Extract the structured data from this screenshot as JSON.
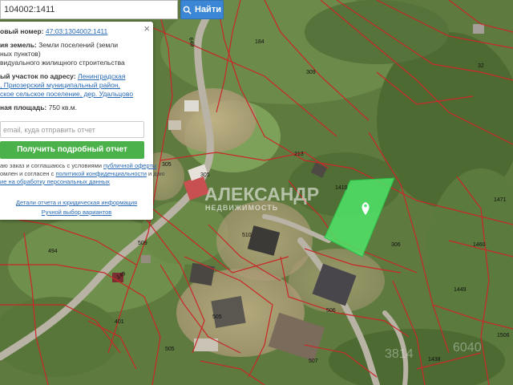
{
  "search": {
    "value": "104002:1411",
    "button_label": "Найти",
    "button_icon": "search-icon"
  },
  "panel": {
    "close_glyph": "×",
    "cad_label": "овый номер:",
    "cad_value": "47:03:1304002:1411",
    "category_label": "ия земель:",
    "category_value_1": "Земли поселений (земли",
    "category_value_2": "ных пунктов)",
    "use_value": "видуального жилищного строительства",
    "address_label": "ый участок по адресу:",
    "address_1": "Ленинградская",
    "address_2": ", Приозерский муниципальный район,",
    "address_3": "ское сельское поселение, дер. Удальцово",
    "area_label": "ная площадь:",
    "area_value": "750 кв.м.",
    "email_placeholder": "email, куда отправить отчет",
    "cta_label": "Получить подробный отчет",
    "consent_1a": "аю заказ и соглашаюсь с условиями ",
    "consent_1b": "публичной оферты",
    "consent_2a": "омлен и согласен с ",
    "consent_2b": "политикой конфиденциальности",
    "consent_2c": " и даю",
    "consent_3": "ие на обработку персональных данных",
    "link_details": "Детали отчета и юридическая информация",
    "link_manual": "Ручной выбор вариантов"
  },
  "map": {
    "plot_labels": [
      "184",
      "309",
      "32",
      "213",
      "1410",
      "305",
      "305",
      "1471",
      "510",
      "306",
      "1460",
      "509",
      "494",
      "401",
      "506",
      "1449",
      "505",
      "1506",
      "505",
      "507",
      "1438",
      "149",
      "649"
    ],
    "watermark_1": "АЛЕКСАНДР",
    "watermark_2": "НЕДВИЖИМОСТЬ",
    "watermark_3": "3814",
    "watermark_4": "6040",
    "highlight_color": "#4ee86a",
    "boundary_color": "#c82828",
    "pin_icon": "map-pin-icon"
  }
}
